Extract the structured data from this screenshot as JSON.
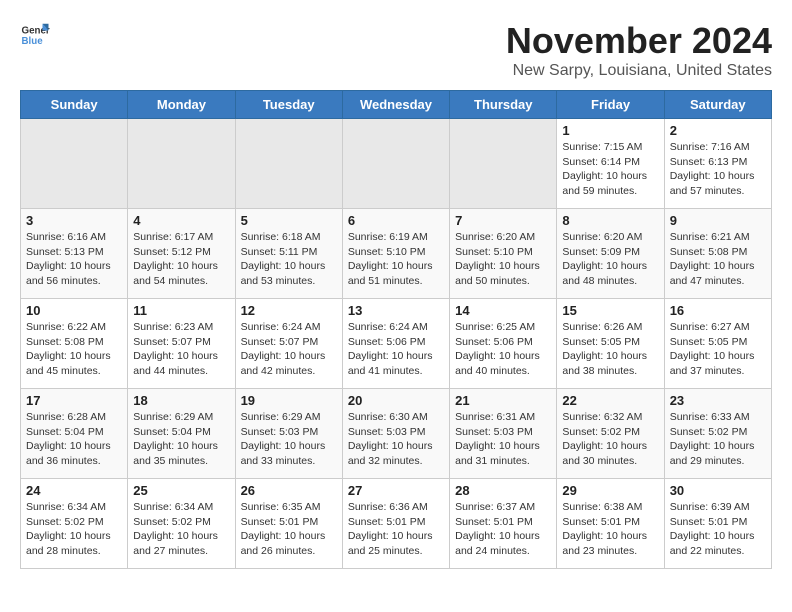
{
  "logo": {
    "line1": "General",
    "line2": "Blue"
  },
  "title": "November 2024",
  "location": "New Sarpy, Louisiana, United States",
  "weekdays": [
    "Sunday",
    "Monday",
    "Tuesday",
    "Wednesday",
    "Thursday",
    "Friday",
    "Saturday"
  ],
  "weeks": [
    [
      {
        "day": "",
        "info": ""
      },
      {
        "day": "",
        "info": ""
      },
      {
        "day": "",
        "info": ""
      },
      {
        "day": "",
        "info": ""
      },
      {
        "day": "",
        "info": ""
      },
      {
        "day": "1",
        "info": "Sunrise: 7:15 AM\nSunset: 6:14 PM\nDaylight: 10 hours\nand 59 minutes."
      },
      {
        "day": "2",
        "info": "Sunrise: 7:16 AM\nSunset: 6:13 PM\nDaylight: 10 hours\nand 57 minutes."
      }
    ],
    [
      {
        "day": "3",
        "info": "Sunrise: 6:16 AM\nSunset: 5:13 PM\nDaylight: 10 hours\nand 56 minutes."
      },
      {
        "day": "4",
        "info": "Sunrise: 6:17 AM\nSunset: 5:12 PM\nDaylight: 10 hours\nand 54 minutes."
      },
      {
        "day": "5",
        "info": "Sunrise: 6:18 AM\nSunset: 5:11 PM\nDaylight: 10 hours\nand 53 minutes."
      },
      {
        "day": "6",
        "info": "Sunrise: 6:19 AM\nSunset: 5:10 PM\nDaylight: 10 hours\nand 51 minutes."
      },
      {
        "day": "7",
        "info": "Sunrise: 6:20 AM\nSunset: 5:10 PM\nDaylight: 10 hours\nand 50 minutes."
      },
      {
        "day": "8",
        "info": "Sunrise: 6:20 AM\nSunset: 5:09 PM\nDaylight: 10 hours\nand 48 minutes."
      },
      {
        "day": "9",
        "info": "Sunrise: 6:21 AM\nSunset: 5:08 PM\nDaylight: 10 hours\nand 47 minutes."
      }
    ],
    [
      {
        "day": "10",
        "info": "Sunrise: 6:22 AM\nSunset: 5:08 PM\nDaylight: 10 hours\nand 45 minutes."
      },
      {
        "day": "11",
        "info": "Sunrise: 6:23 AM\nSunset: 5:07 PM\nDaylight: 10 hours\nand 44 minutes."
      },
      {
        "day": "12",
        "info": "Sunrise: 6:24 AM\nSunset: 5:07 PM\nDaylight: 10 hours\nand 42 minutes."
      },
      {
        "day": "13",
        "info": "Sunrise: 6:24 AM\nSunset: 5:06 PM\nDaylight: 10 hours\nand 41 minutes."
      },
      {
        "day": "14",
        "info": "Sunrise: 6:25 AM\nSunset: 5:06 PM\nDaylight: 10 hours\nand 40 minutes."
      },
      {
        "day": "15",
        "info": "Sunrise: 6:26 AM\nSunset: 5:05 PM\nDaylight: 10 hours\nand 38 minutes."
      },
      {
        "day": "16",
        "info": "Sunrise: 6:27 AM\nSunset: 5:05 PM\nDaylight: 10 hours\nand 37 minutes."
      }
    ],
    [
      {
        "day": "17",
        "info": "Sunrise: 6:28 AM\nSunset: 5:04 PM\nDaylight: 10 hours\nand 36 minutes."
      },
      {
        "day": "18",
        "info": "Sunrise: 6:29 AM\nSunset: 5:04 PM\nDaylight: 10 hours\nand 35 minutes."
      },
      {
        "day": "19",
        "info": "Sunrise: 6:29 AM\nSunset: 5:03 PM\nDaylight: 10 hours\nand 33 minutes."
      },
      {
        "day": "20",
        "info": "Sunrise: 6:30 AM\nSunset: 5:03 PM\nDaylight: 10 hours\nand 32 minutes."
      },
      {
        "day": "21",
        "info": "Sunrise: 6:31 AM\nSunset: 5:03 PM\nDaylight: 10 hours\nand 31 minutes."
      },
      {
        "day": "22",
        "info": "Sunrise: 6:32 AM\nSunset: 5:02 PM\nDaylight: 10 hours\nand 30 minutes."
      },
      {
        "day": "23",
        "info": "Sunrise: 6:33 AM\nSunset: 5:02 PM\nDaylight: 10 hours\nand 29 minutes."
      }
    ],
    [
      {
        "day": "24",
        "info": "Sunrise: 6:34 AM\nSunset: 5:02 PM\nDaylight: 10 hours\nand 28 minutes."
      },
      {
        "day": "25",
        "info": "Sunrise: 6:34 AM\nSunset: 5:02 PM\nDaylight: 10 hours\nand 27 minutes."
      },
      {
        "day": "26",
        "info": "Sunrise: 6:35 AM\nSunset: 5:01 PM\nDaylight: 10 hours\nand 26 minutes."
      },
      {
        "day": "27",
        "info": "Sunrise: 6:36 AM\nSunset: 5:01 PM\nDaylight: 10 hours\nand 25 minutes."
      },
      {
        "day": "28",
        "info": "Sunrise: 6:37 AM\nSunset: 5:01 PM\nDaylight: 10 hours\nand 24 minutes."
      },
      {
        "day": "29",
        "info": "Sunrise: 6:38 AM\nSunset: 5:01 PM\nDaylight: 10 hours\nand 23 minutes."
      },
      {
        "day": "30",
        "info": "Sunrise: 6:39 AM\nSunset: 5:01 PM\nDaylight: 10 hours\nand 22 minutes."
      }
    ]
  ]
}
